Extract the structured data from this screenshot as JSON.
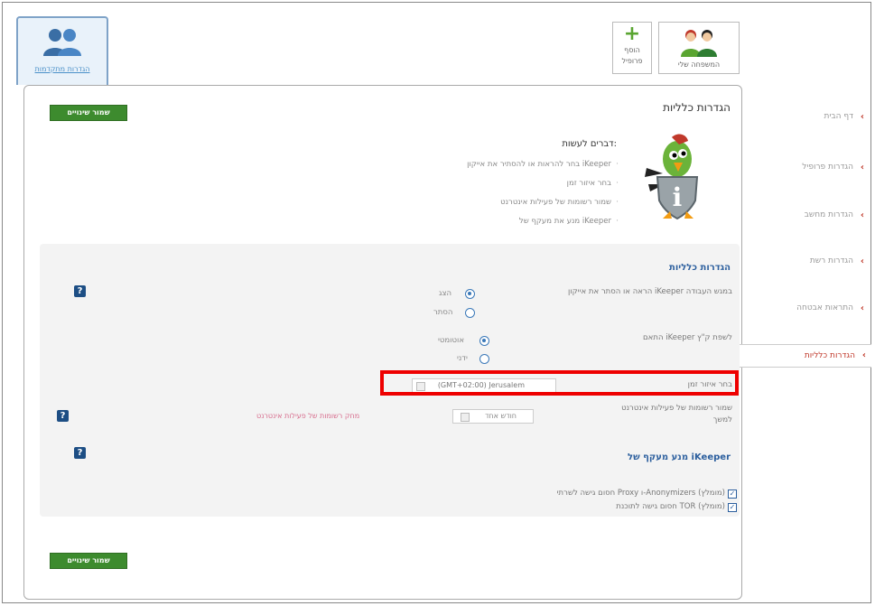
{
  "header": {
    "parental_tab_label": "הגדרות מתקדמות",
    "add_profile_label_line1": "הוסף",
    "add_profile_label_line2": "פרופיל",
    "my_family_label": "המשפחה שלי"
  },
  "sidebar": {
    "items": [
      {
        "label": "דף הבית"
      },
      {
        "label": "הגדרות פרופיל"
      },
      {
        "label": "הגדרות מחשב"
      },
      {
        "label": "הגדרות רשת"
      },
      {
        "label": "התראות אבטחה"
      },
      {
        "label": "הגדרות כלליות"
      }
    ],
    "active_index": 5
  },
  "main": {
    "title": "הגדרות כלליות",
    "save_button_label": "שמור שינויים",
    "todo": {
      "title": "דברים לעשות:",
      "items": [
        "בחר להראות או להסתיר את אייקון iKeeper",
        "בחר איזור זמן",
        "שמור רשומות של פעילות אינטרנט",
        "מנע את מעקף של iKeeper"
      ]
    },
    "general": {
      "title": "הגדרות כלליות",
      "show_hide_question": "הראה או הסתר את אייקון iKeeper במגש העבודה",
      "show_label": "הצג",
      "hide_label": "הסתר",
      "language_question": "התאם iKeeper לשפת ק\"ץ",
      "auto_label": "אוטומטי",
      "manual_label": "ידני",
      "timezone_label": "בחר איזור זמן",
      "timezone_value": "(GMT+02:00) Jerusalem",
      "save_records_question_line1": "שמור רשומות של פעילות אינטרנט",
      "save_records_question_line2": "למשך",
      "save_records_value": "חודש אחד",
      "delete_records_link": "מחק רשומות של פעילות אינטרנט"
    },
    "bypass": {
      "title": "מנע מעקף של iKeeper",
      "proxy_label": "חסום גישה לשרתי Proxy ו-Anonymizers (מומלץ)",
      "tor_label": "חסום גישה לתוכנת TOR (מומלץ)"
    }
  },
  "colors": {
    "green_button": "#3d8b2e",
    "accent_blue": "#2c5f9e",
    "highlight_red": "#ee0000",
    "link_pink": "#d76b8c"
  },
  "icons": {
    "help": "question-icon",
    "chevron": "chevron-left-icon",
    "mascot": "parrot-shield-icon"
  }
}
